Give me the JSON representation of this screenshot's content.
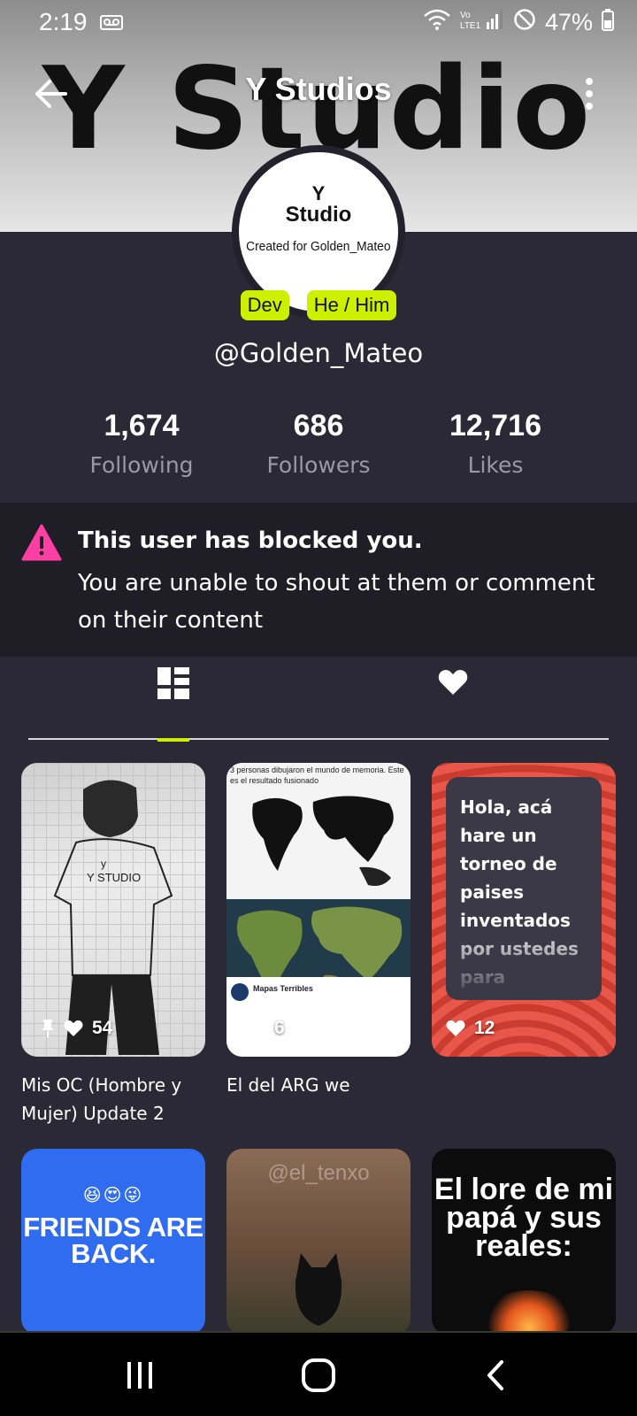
{
  "status_bar": {
    "time": "2:19",
    "battery": "47%"
  },
  "banner": {
    "text": "Y Studio"
  },
  "header": {
    "title": "Y Studios"
  },
  "avatar": {
    "line1": "Y",
    "line2": "Studio",
    "line3": "Created for Golden_Mateo"
  },
  "badges": [
    "Dev",
    "He / Him"
  ],
  "profile": {
    "username": "@Golden_Mateo"
  },
  "stats": [
    {
      "value": "1,674",
      "label": "Following"
    },
    {
      "value": "686",
      "label": "Followers"
    },
    {
      "value": "12,716",
      "label": "Likes"
    }
  ],
  "notice": {
    "title": "This user has blocked you.",
    "body": "You are unable to shout at them or comment on their content"
  },
  "tabs": {
    "active": "posts",
    "items": [
      "posts-grid",
      "likes"
    ]
  },
  "posts": [
    {
      "title": "Mis OC (Hombre y Mujer) Update 2",
      "likes": "54",
      "pinned": true,
      "image_text": "Y STUDIO"
    },
    {
      "title": "El del ARG we",
      "likes": "6",
      "image_caption": "3 personas dibujaron el mundo de memoria. Este es el resultado fusionado",
      "image_handle": "Mapas Terribles"
    },
    {
      "title": "",
      "likes": "12",
      "preview_text": "Hola, acá hare un torneo de paises inventados por ustedes para"
    },
    {
      "image_text": "FRIENDS ARE BACK."
    },
    {
      "image_text": "@el_tenxo"
    },
    {
      "image_text": "El lore de mi papá y sus reales:"
    }
  ],
  "colors": {
    "accent": "#ccf000",
    "background": "#2b2935",
    "notice_bg": "#1f1e26",
    "warning": "#ff3fa4",
    "muted_text": "#9a99a3"
  }
}
